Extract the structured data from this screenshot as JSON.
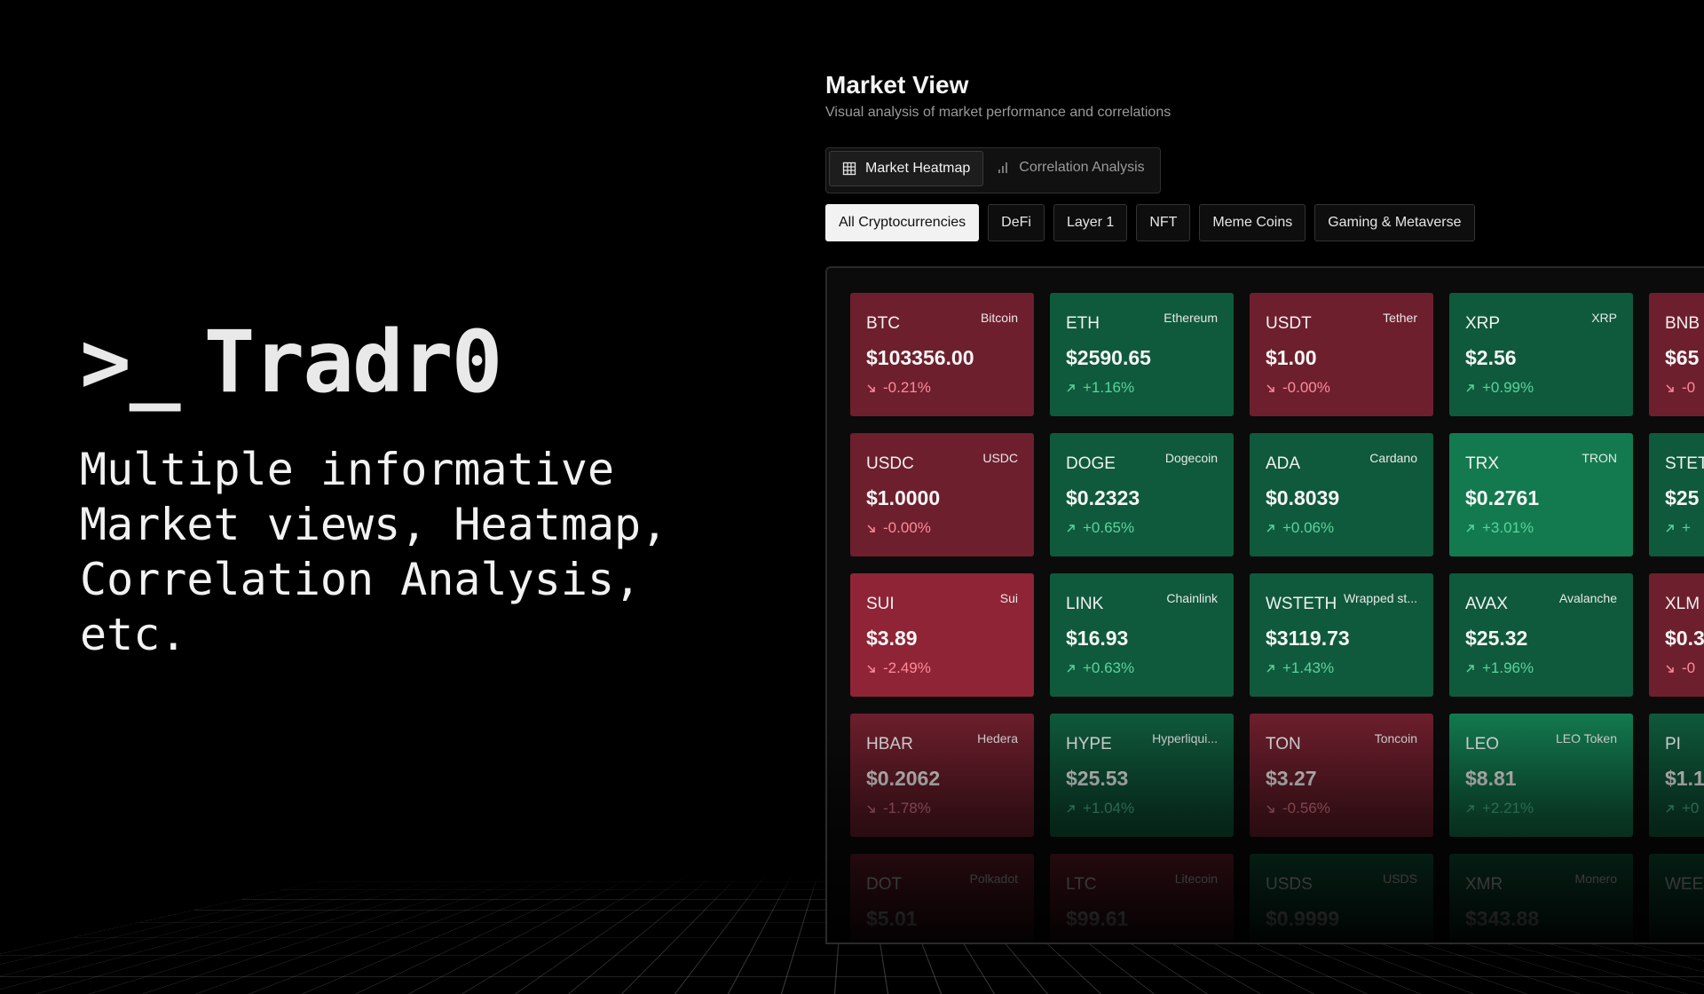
{
  "brand": {
    "prompt": ">_",
    "name": "Tradr0"
  },
  "tagline": "Multiple informative\nMarket views, Heatmap,\nCorrelation Analysis,\netc.",
  "market_view": {
    "title": "Market View",
    "subtitle": "Visual analysis of market performance and correlations",
    "tabs": [
      {
        "label": "Market Heatmap",
        "icon": "grid-icon",
        "active": true
      },
      {
        "label": "Correlation Analysis",
        "icon": "bar-chart-icon",
        "active": false
      }
    ],
    "filters": [
      {
        "label": "All Cryptocurrencies",
        "active": true
      },
      {
        "label": "DeFi",
        "active": false
      },
      {
        "label": "Layer 1",
        "active": false
      },
      {
        "label": "NFT",
        "active": false
      },
      {
        "label": "Meme Coins",
        "active": false
      },
      {
        "label": "Gaming & Metaverse",
        "active": false
      }
    ],
    "tiles": [
      {
        "symbol": "BTC",
        "name": "Bitcoin",
        "price": "$103356.00",
        "change": "-0.21%",
        "dir": "down"
      },
      {
        "symbol": "ETH",
        "name": "Ethereum",
        "price": "$2590.65",
        "change": "+1.16%",
        "dir": "up"
      },
      {
        "symbol": "USDT",
        "name": "Tether",
        "price": "$1.00",
        "change": "-0.00%",
        "dir": "down"
      },
      {
        "symbol": "XRP",
        "name": "XRP",
        "price": "$2.56",
        "change": "+0.99%",
        "dir": "up"
      },
      {
        "symbol": "BNB",
        "name": "",
        "price": "$65",
        "change": "-0",
        "dir": "down"
      },
      {
        "symbol": "USDC",
        "name": "USDC",
        "price": "$1.0000",
        "change": "-0.00%",
        "dir": "down"
      },
      {
        "symbol": "DOGE",
        "name": "Dogecoin",
        "price": "$0.2323",
        "change": "+0.65%",
        "dir": "up"
      },
      {
        "symbol": "ADA",
        "name": "Cardano",
        "price": "$0.8039",
        "change": "+0.06%",
        "dir": "up"
      },
      {
        "symbol": "TRX",
        "name": "TRON",
        "price": "$0.2761",
        "change": "+3.01%",
        "dir": "up",
        "strong": true
      },
      {
        "symbol": "STETH",
        "name": "",
        "price": "$25",
        "change": "+",
        "dir": "up"
      },
      {
        "symbol": "SUI",
        "name": "Sui",
        "price": "$3.89",
        "change": "-2.49%",
        "dir": "down",
        "strong": true
      },
      {
        "symbol": "LINK",
        "name": "Chainlink",
        "price": "$16.93",
        "change": "+0.63%",
        "dir": "up"
      },
      {
        "symbol": "WSTETH",
        "name": "Wrapped st...",
        "price": "$3119.73",
        "change": "+1.43%",
        "dir": "up"
      },
      {
        "symbol": "AVAX",
        "name": "Avalanche",
        "price": "$25.32",
        "change": "+1.96%",
        "dir": "up"
      },
      {
        "symbol": "XLM",
        "name": "",
        "price": "$0.3",
        "change": "-0",
        "dir": "down"
      },
      {
        "symbol": "HBAR",
        "name": "Hedera",
        "price": "$0.2062",
        "change": "-1.78%",
        "dir": "down"
      },
      {
        "symbol": "HYPE",
        "name": "Hyperliqui...",
        "price": "$25.53",
        "change": "+1.04%",
        "dir": "up"
      },
      {
        "symbol": "TON",
        "name": "Toncoin",
        "price": "$3.27",
        "change": "-0.56%",
        "dir": "down"
      },
      {
        "symbol": "LEO",
        "name": "LEO Token",
        "price": "$8.81",
        "change": "+2.21%",
        "dir": "up",
        "strong": true
      },
      {
        "symbol": "PI",
        "name": "",
        "price": "$1.1",
        "change": "+0",
        "dir": "up"
      },
      {
        "symbol": "DOT",
        "name": "Polkadot",
        "price": "$5.01",
        "change": "",
        "dir": "down"
      },
      {
        "symbol": "LTC",
        "name": "Litecoin",
        "price": "$99.61",
        "change": "",
        "dir": "down"
      },
      {
        "symbol": "USDS",
        "name": "USDS",
        "price": "$0.9999",
        "change": "",
        "dir": "up"
      },
      {
        "symbol": "XMR",
        "name": "Monero",
        "price": "$343.88",
        "change": "",
        "dir": "up"
      },
      {
        "symbol": "WEET",
        "name": "",
        "price": "",
        "change": "",
        "dir": "up"
      }
    ]
  }
}
